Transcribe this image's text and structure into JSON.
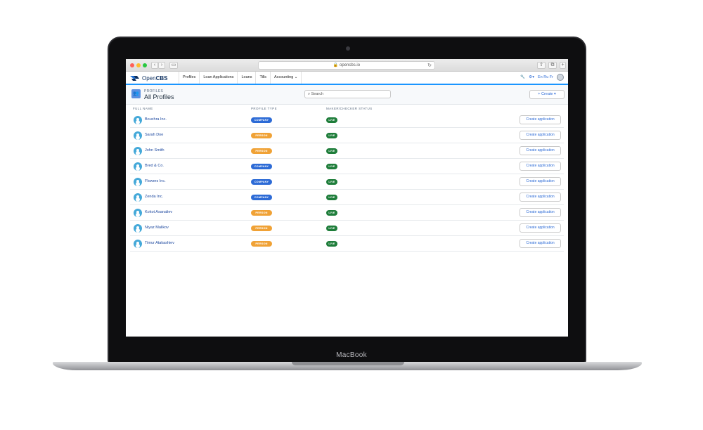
{
  "device": {
    "brand": "MacBook"
  },
  "browser": {
    "url": "opencbs.io",
    "back": "‹",
    "forward": "›"
  },
  "app": {
    "logo": {
      "prefix": "Open",
      "suffix": "CBS"
    },
    "nav": [
      "Profiles",
      "Loan Applications",
      "Loans",
      "Tills",
      "Accounting"
    ],
    "languages": "En Ru Fr"
  },
  "page": {
    "kicker": "PROFILES",
    "title": "All Profiles",
    "search_placeholder": "Search",
    "create_label": "Create"
  },
  "table": {
    "columns": [
      "FULL NAME",
      "PROFILE TYPE",
      "MAKER/CHECKER STATUS"
    ],
    "action_label": "Create application",
    "rows": [
      {
        "name": "Bouchra Inc.",
        "type": "COMPANY",
        "status": "LIVE"
      },
      {
        "name": "Sarah Doe",
        "type": "PERSON",
        "status": "LIVE"
      },
      {
        "name": "John Smith",
        "type": "PERSON",
        "status": "LIVE"
      },
      {
        "name": "Bred & Co.",
        "type": "COMPANY",
        "status": "LIVE"
      },
      {
        "name": "Flowers Inc.",
        "type": "COMPANY",
        "status": "LIVE"
      },
      {
        "name": "Zenda Inc.",
        "type": "COMPANY",
        "status": "LIVE"
      },
      {
        "name": "Kokot Asanaliev",
        "type": "PERSON",
        "status": "LIVE"
      },
      {
        "name": "Niyaz Malikov",
        "type": "PERSON",
        "status": "LIVE"
      },
      {
        "name": "Timur Atakashiev",
        "type": "PERSON",
        "status": "LIVE"
      }
    ]
  },
  "colors": {
    "company_badge": "#2d6bd6",
    "person_badge": "#f0a236",
    "live_badge": "#1e7d3a",
    "accent": "#1b96ff"
  }
}
